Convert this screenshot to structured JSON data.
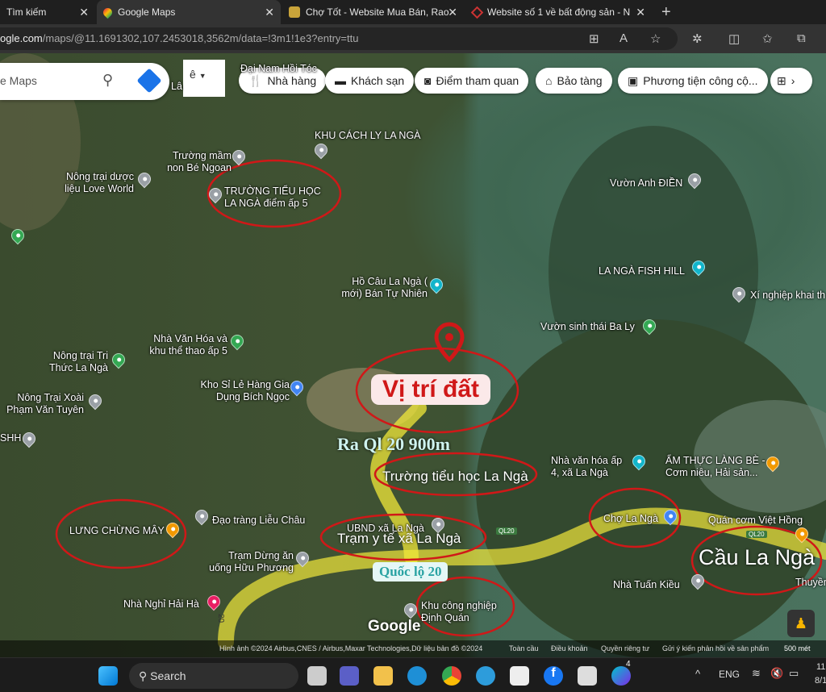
{
  "browser": {
    "tabs": [
      {
        "label": "Tìm kiếm"
      },
      {
        "label": "Google Maps"
      },
      {
        "label": "Chợ Tốt - Website Mua Bán, Rao"
      },
      {
        "label": "Website số 1 về bất động sản - N"
      }
    ],
    "url_domain": "ogle.com",
    "url_path": "/maps/@11.1691302,107.2453018,3562m/data=!3m1!1e3?entry=ttu"
  },
  "maps": {
    "search_placeholder": "e Maps",
    "layer_label": "ê",
    "chips": [
      "Nhà hàng",
      "Khách sạn",
      "Điểm tham quan",
      "Bảo tàng",
      "Phương tiện công cộ..."
    ],
    "places": [
      "Đại Nam Hồi Tóc",
      "KHU CÁCH LY LA NGÀ",
      "Trường mầm non Bé Ngoan",
      "Nông trại dược liệu Love World",
      "TRƯỜNG TIỂU HỌC LA NGÀ điểm ấp 5",
      "Vườn Anh ĐIỀN",
      "LA NGÀ FISH HILL",
      "Hồ Câu La Ngà ( mới) Bán Tự Nhiên",
      "Xí nghiệp khai th",
      "Vườn sinh thái Ba Ly",
      "Nhà Văn Hóa và khu thể thao ấp 5",
      "Nông trại Tri Thức La Ngà",
      "Kho Sỉ Lẻ Hàng Gia Dụng Bích Ngọc",
      "Nông Trại Xoài Phạm Văn Tuyên",
      "SHH",
      "Nhà văn hóa ấp 4, xã La Ngà",
      "ẨM THỰC LÀNG BÈ - Cơm niêu, Hải sản...",
      "Chợ La Ngà",
      "Quán cơm Việt Hồng",
      "LƯNG CHỪNG MÂY",
      "Đạo tràng Liễu Châu",
      "UBND xã La Ngà",
      "Trạm Dừng ăn uống Hữu Phương",
      "Nhà Nghỉ Hải Hà",
      "Khu công nghiệp Định Quán",
      "Nhà Tuấn Kiều",
      "Thuyền",
      "Lâ"
    ],
    "road_shield": "QL20",
    "google_logo": "Google",
    "footer": {
      "imagery": "Hình ảnh ©2024 Airbus,CNES / Airbus,Maxar Technologies,Dữ liệu bản đồ ©2024",
      "global": "Toàn cầu",
      "terms": "Điều khoản",
      "privacy": "Quyền riêng tư",
      "feedback": "Gửi ý kiến phản hồi về sản phẩm",
      "scale": "500 mét"
    }
  },
  "annotations": {
    "location": "Vị trí đất",
    "to_ql20": "Ra Ql 20 900m",
    "school": "Trường tiểu học La Ngà",
    "clinic": "Trạm y tế xã La Ngà",
    "highway": "Quốc lộ 20",
    "bridge": "Cầu La Ngà",
    "road_vertical": "20",
    "highlight_color": "#f2e83a",
    "circle_color": "#d01818"
  },
  "taskbar": {
    "search": "Search",
    "lang": "ENG",
    "time": "11",
    "date": "8/1",
    "canva_badge": "4"
  }
}
